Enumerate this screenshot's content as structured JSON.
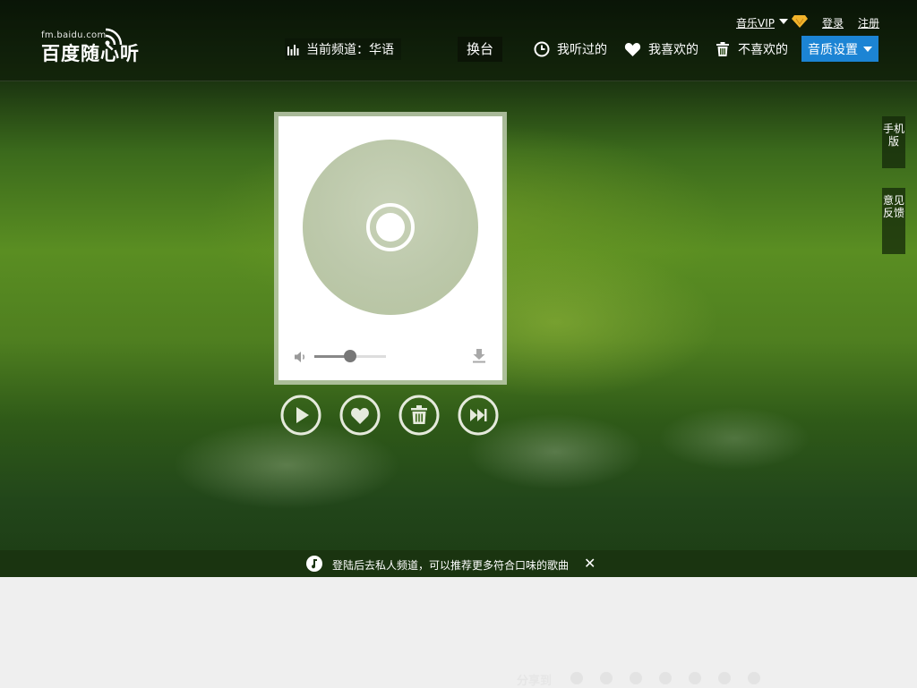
{
  "brand": {
    "domain": "fm.baidu.com",
    "name": "百度随心听"
  },
  "channel": {
    "prefix": "当前频道：",
    "name": "华语"
  },
  "switch_label": "换台",
  "nav": {
    "history": "我听过的",
    "favorites": "我喜欢的",
    "disliked": "不喜欢的",
    "quality": "音质设置"
  },
  "top_links": {
    "vip": "音乐VIP",
    "login": "登录",
    "register": "注册"
  },
  "side_tabs": {
    "mobile": "手机版",
    "feedback": "意见反馈"
  },
  "player": {
    "volume": 0.5
  },
  "notice": {
    "text": "登陆后去私人频道，可以推荐更多符合口味的歌曲",
    "close": "✕"
  },
  "footer": {
    "share_label": "分享到"
  },
  "colors": {
    "accent_blue": "#1c84d4",
    "notice_bg": "#1a3410"
  }
}
